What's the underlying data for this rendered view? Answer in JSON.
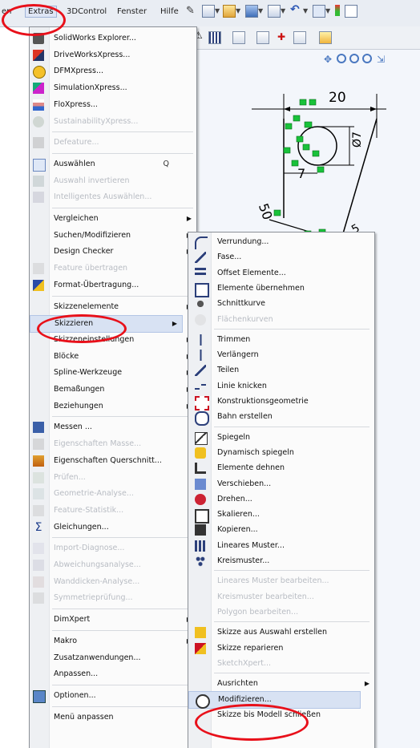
{
  "menubar": {
    "items": [
      "en",
      "Extras",
      "3DControl",
      "Fenster",
      "Hilfe"
    ]
  },
  "drawing": {
    "dims": [
      "20",
      "Ø7",
      "7",
      "50",
      "5"
    ]
  },
  "main_menu": {
    "items": [
      {
        "label": "SolidWorks Explorer...",
        "icon": "explorer-icon",
        "enabled": true
      },
      {
        "label": "DriveWorksXpress...",
        "icon": "driveworks-icon",
        "enabled": true
      },
      {
        "label": "DFMXpress...",
        "icon": "dfm-icon",
        "enabled": true
      },
      {
        "label": "SimulationXpress...",
        "icon": "simulation-icon",
        "enabled": true
      },
      {
        "label": "FloXpress...",
        "icon": "floxpress-icon",
        "enabled": true
      },
      {
        "label": "SustainabilityXpress...",
        "icon": "sustainability-icon",
        "enabled": false
      },
      {
        "label": "Defeature...",
        "icon": "defeature-icon",
        "enabled": false
      },
      {
        "label": "Auswählen",
        "icon": "select-icon",
        "enabled": true,
        "shortcut": "Q"
      },
      {
        "label": "Auswahl invertieren",
        "icon": "invert-select-icon",
        "enabled": false
      },
      {
        "label": "Intelligentes Auswählen...",
        "icon": "smart-select-icon",
        "enabled": false
      },
      {
        "label": "Vergleichen",
        "enabled": true,
        "submenu": true
      },
      {
        "label": "Suchen/Modifizieren",
        "enabled": true,
        "submenu": true
      },
      {
        "label": "Design Checker",
        "enabled": true,
        "submenu": true
      },
      {
        "label": "Feature übertragen",
        "icon": "feature-transfer-icon",
        "enabled": false
      },
      {
        "label": "Format-Übertragung...",
        "icon": "format-painter-icon",
        "enabled": true
      },
      {
        "label": "Skizzenelemente",
        "enabled": true,
        "submenu": true
      },
      {
        "label": "Skizzieren",
        "enabled": true,
        "submenu": true
      },
      {
        "label": "Skizzeneinstellungen",
        "enabled": true,
        "submenu": true
      },
      {
        "label": "Blöcke",
        "enabled": true,
        "submenu": true
      },
      {
        "label": "Spline-Werkzeuge",
        "enabled": true,
        "submenu": true
      },
      {
        "label": "Bemaßungen",
        "enabled": true,
        "submenu": true
      },
      {
        "label": "Beziehungen",
        "enabled": true,
        "submenu": true
      },
      {
        "label": "Messen ...",
        "icon": "measure-icon",
        "enabled": true
      },
      {
        "label": "Eigenschaften Masse...",
        "icon": "mass-props-icon",
        "enabled": false
      },
      {
        "label": "Eigenschaften Querschnitt...",
        "icon": "section-props-icon",
        "enabled": true
      },
      {
        "label": "Prüfen...",
        "icon": "check-icon",
        "enabled": false
      },
      {
        "label": "Geometrie-Analyse...",
        "icon": "geometry-analysis-icon",
        "enabled": false
      },
      {
        "label": "Feature-Statistik...",
        "icon": "feature-stats-icon",
        "enabled": false
      },
      {
        "label": "Gleichungen...",
        "icon": "sigma-icon",
        "enabled": true
      },
      {
        "label": "Import-Diagnose...",
        "icon": "import-diag-icon",
        "enabled": false
      },
      {
        "label": "Abweichungsanalyse...",
        "icon": "deviation-icon",
        "enabled": false
      },
      {
        "label": "Wanddicken-Analyse...",
        "icon": "thickness-icon",
        "enabled": false
      },
      {
        "label": "Symmetrieprüfung...",
        "icon": "symmetry-icon",
        "enabled": false
      },
      {
        "label": "DimXpert",
        "enabled": true,
        "submenu": true
      },
      {
        "label": "Makro",
        "enabled": true,
        "submenu": true
      },
      {
        "label": "Zusatzanwendungen...",
        "enabled": true
      },
      {
        "label": "Anpassen...",
        "enabled": true
      },
      {
        "label": "Optionen...",
        "icon": "options-icon",
        "enabled": true
      },
      {
        "label": "Menü anpassen",
        "enabled": true
      }
    ]
  },
  "sub_menu": {
    "items": [
      {
        "label": "Verrundung...",
        "icon": "fillet-icon",
        "enabled": true
      },
      {
        "label": "Fase...",
        "icon": "chamfer-icon",
        "enabled": true
      },
      {
        "label": "Offset Elemente...",
        "icon": "offset-icon",
        "enabled": true
      },
      {
        "label": "Elemente übernehmen",
        "icon": "convert-entities-icon",
        "enabled": true
      },
      {
        "label": "Schnittkurve",
        "icon": "intersection-curve-icon",
        "enabled": true
      },
      {
        "label": "Flächenkurven",
        "icon": "face-curves-icon",
        "enabled": false
      },
      {
        "label": "Trimmen",
        "icon": "trim-icon",
        "enabled": true
      },
      {
        "label": "Verlängern",
        "icon": "extend-icon",
        "enabled": true
      },
      {
        "label": "Teilen",
        "icon": "split-icon",
        "enabled": true
      },
      {
        "label": "Linie knicken",
        "icon": "jog-line-icon",
        "enabled": true
      },
      {
        "label": "Konstruktionsgeometrie",
        "icon": "construction-icon",
        "enabled": true
      },
      {
        "label": "Bahn erstellen",
        "icon": "slot-icon",
        "enabled": true
      },
      {
        "label": "Spiegeln",
        "icon": "mirror-icon",
        "enabled": true
      },
      {
        "label": "Dynamisch spiegeln",
        "icon": "dynamic-mirror-icon",
        "enabled": true
      },
      {
        "label": "Elemente dehnen",
        "icon": "stretch-icon",
        "enabled": true
      },
      {
        "label": "Verschieben...",
        "icon": "move-icon",
        "enabled": true
      },
      {
        "label": "Drehen...",
        "icon": "rotate-icon",
        "enabled": true
      },
      {
        "label": "Skalieren...",
        "icon": "scale-icon",
        "enabled": true
      },
      {
        "label": "Kopieren...",
        "icon": "copy-icon",
        "enabled": true
      },
      {
        "label": "Lineares Muster...",
        "icon": "linear-pattern-icon",
        "enabled": true
      },
      {
        "label": "Kreismuster...",
        "icon": "circular-pattern-icon",
        "enabled": true
      },
      {
        "label": "Lineares Muster bearbeiten...",
        "enabled": false
      },
      {
        "label": "Kreismuster bearbeiten...",
        "enabled": false
      },
      {
        "label": "Polygon bearbeiten...",
        "enabled": false
      },
      {
        "label": "Skizze aus Auswahl erstellen",
        "icon": "sketch-from-selection-icon",
        "enabled": true
      },
      {
        "label": "Skizze reparieren",
        "icon": "repair-sketch-icon",
        "enabled": true
      },
      {
        "label": "SketchXpert...",
        "enabled": false
      },
      {
        "label": "Ausrichten",
        "enabled": true,
        "submenu": true
      },
      {
        "label": "Modifizieren...",
        "icon": "modify-icon",
        "enabled": true
      },
      {
        "label": "Skizze bis Modell schließen",
        "enabled": true
      }
    ]
  }
}
